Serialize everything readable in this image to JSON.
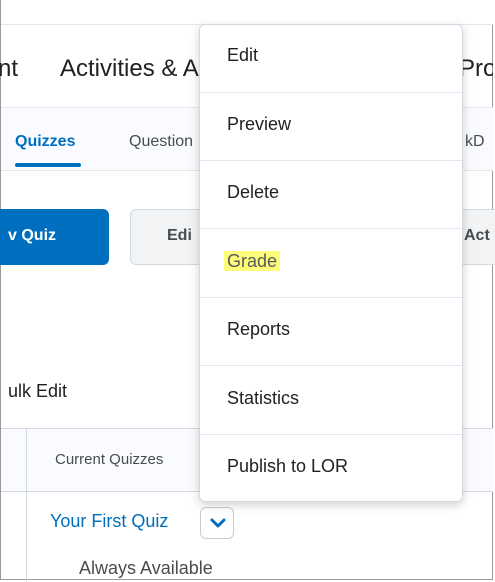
{
  "nav": {
    "title_left_fragment": "nt",
    "title_main": "Activities & A",
    "title_right_fragment": "Pro"
  },
  "tabs": {
    "active": "Quizzes",
    "second": "Question",
    "right_fragment": "kD"
  },
  "toolbar": {
    "new_quiz_label": "v Quiz",
    "edit_label": "Edi",
    "right_fragment": "Act"
  },
  "bulk_edit_label": "ulk Edit",
  "table": {
    "column_header": "Current Quizzes",
    "rows": [
      {
        "title": "Your First Quiz",
        "availability": "Always Available"
      }
    ]
  },
  "menu": {
    "items": [
      {
        "label": "Edit"
      },
      {
        "label": "Preview"
      },
      {
        "label": "Delete"
      },
      {
        "label": "Grade",
        "highlighted": true
      },
      {
        "label": "Reports"
      },
      {
        "label": "Statistics"
      },
      {
        "label": "Publish to LOR"
      }
    ]
  },
  "colors": {
    "brand_blue": "#006fbf",
    "highlight": "#fdfd7a"
  },
  "icons": {
    "row_dropdown": "chevron-down-icon"
  }
}
